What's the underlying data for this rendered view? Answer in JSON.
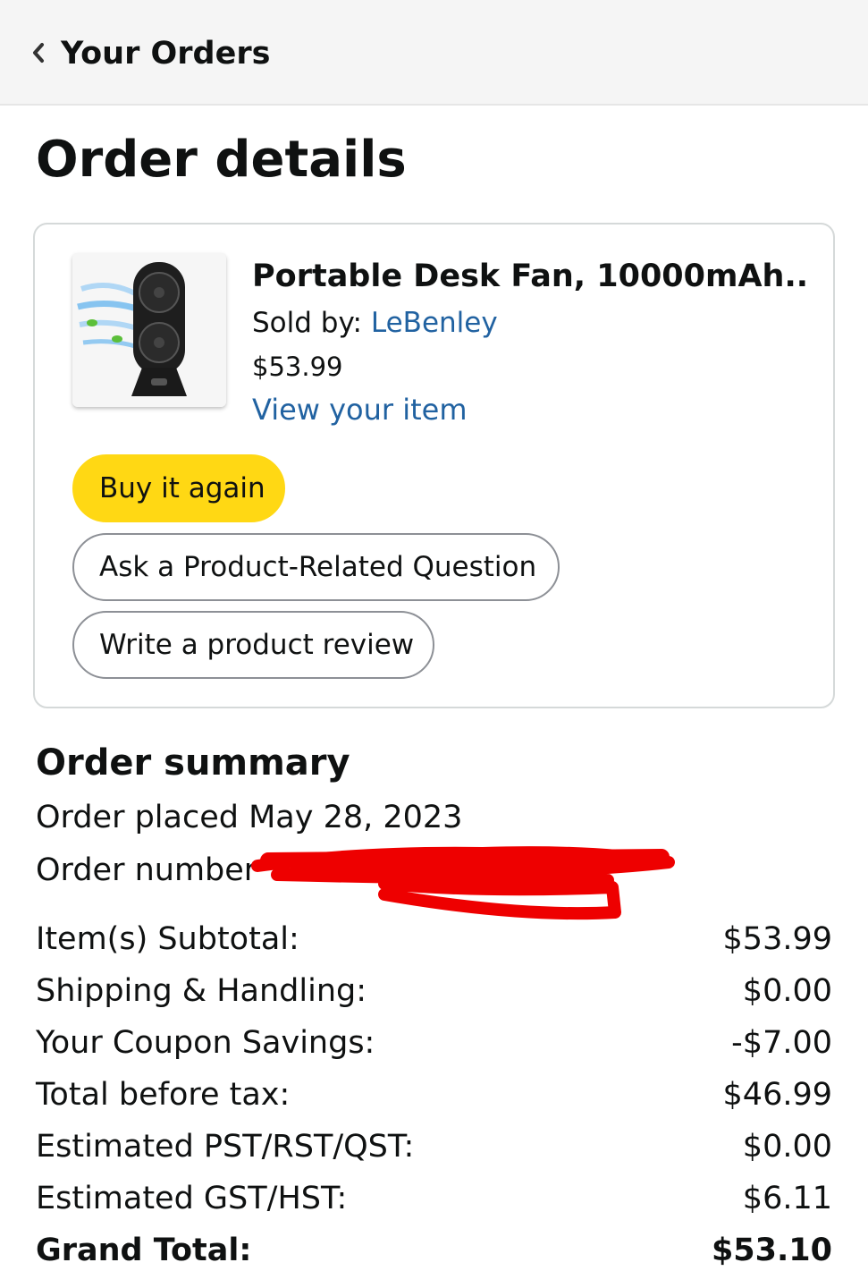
{
  "header": {
    "back_label": "Your Orders",
    "back_icon": "chevron-left-icon"
  },
  "page_title": "Order details",
  "item": {
    "title": "Portable Desk Fan, 10000mAh...",
    "sold_by_label": "Sold by:",
    "seller": "LeBenley",
    "price": "$53.99",
    "view_link": "View your item",
    "image_icon": "desk-fan-product-image"
  },
  "actions": {
    "buy_again": "Buy it again",
    "ask_question": "Ask a Product-Related Question",
    "write_review": "Write a product review"
  },
  "colors": {
    "link": "#2162a1",
    "primary_button": "#ffd814",
    "redaction": "#ee0000"
  },
  "summary": {
    "title": "Order summary",
    "placed": "Order placed May 28, 2023",
    "number_label": "Order number",
    "rows": [
      {
        "label": "Item(s) Subtotal:",
        "amount": "$53.99"
      },
      {
        "label": "Shipping & Handling:",
        "amount": "$0.00"
      },
      {
        "label": "Your Coupon Savings:",
        "amount": "-$7.00"
      },
      {
        "label": "Total before tax:",
        "amount": "$46.99"
      },
      {
        "label": "Estimated PST/RST/QST:",
        "amount": "$0.00"
      },
      {
        "label": "Estimated GST/HST:",
        "amount": "$6.11"
      }
    ],
    "grand_total": {
      "label": "Grand Total:",
      "amount": "$53.10"
    }
  }
}
